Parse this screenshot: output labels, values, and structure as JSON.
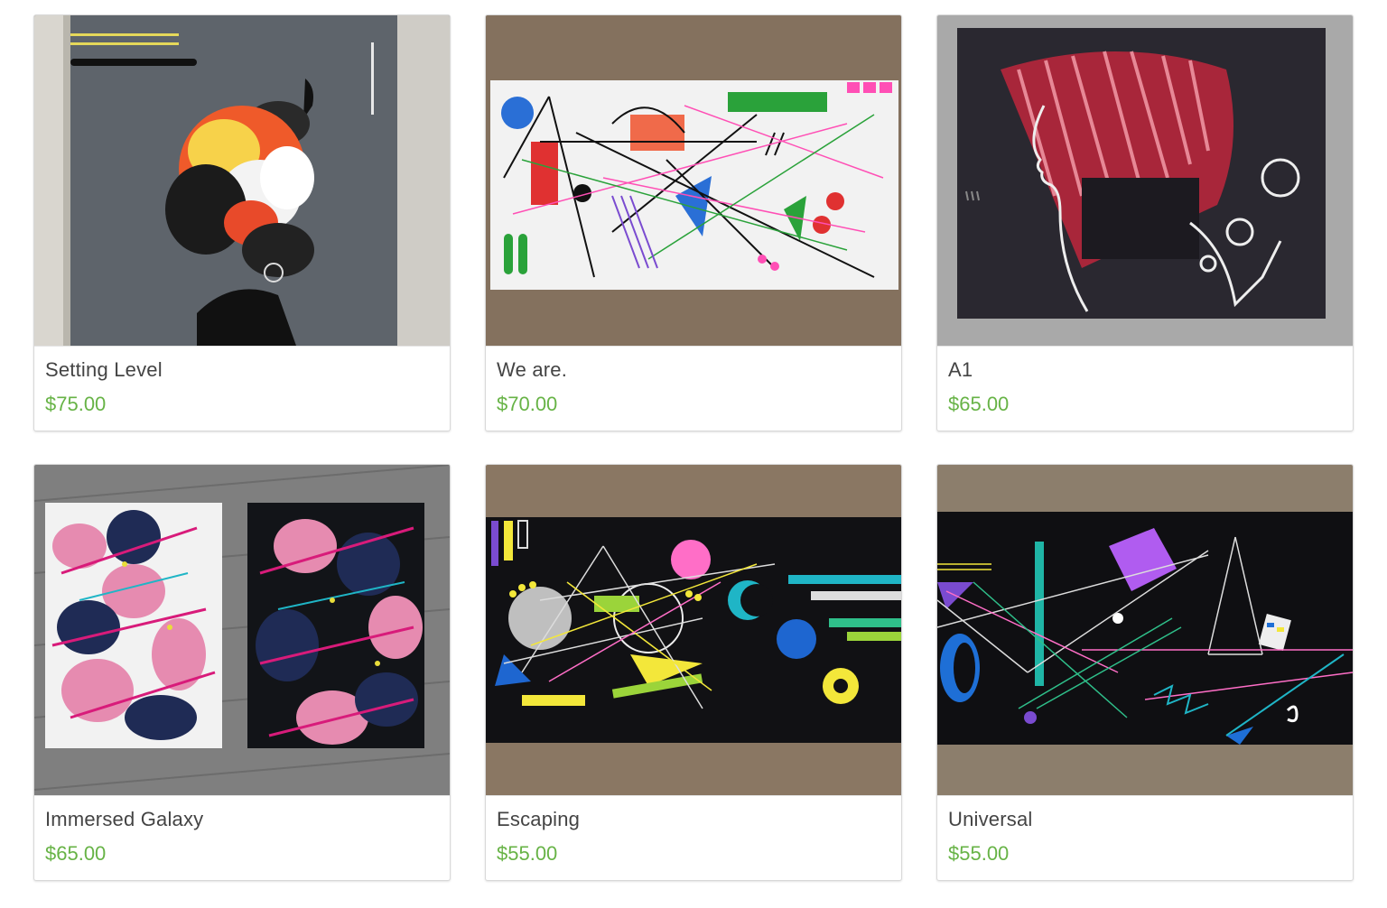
{
  "listings": [
    {
      "title": "Setting Level",
      "price": "$75.00",
      "image_icon": "abstract-portrait-painting"
    },
    {
      "title": "We are.",
      "price": "$70.00",
      "image_icon": "geometric-lines-painting"
    },
    {
      "title": "A1",
      "price": "$65.00",
      "image_icon": "red-hair-profile-painting"
    },
    {
      "title": "Immersed Galaxy",
      "price": "$65.00",
      "image_icon": "splatter-diptych-painting"
    },
    {
      "title": "Escaping",
      "price": "$55.00",
      "image_icon": "geometric-black-painting"
    },
    {
      "title": "Universal",
      "price": "$55.00",
      "image_icon": "geometric-black-painting"
    }
  ],
  "colors": {
    "price": "#67b346",
    "title": "#444444",
    "card_border": "#d8d8d8"
  }
}
